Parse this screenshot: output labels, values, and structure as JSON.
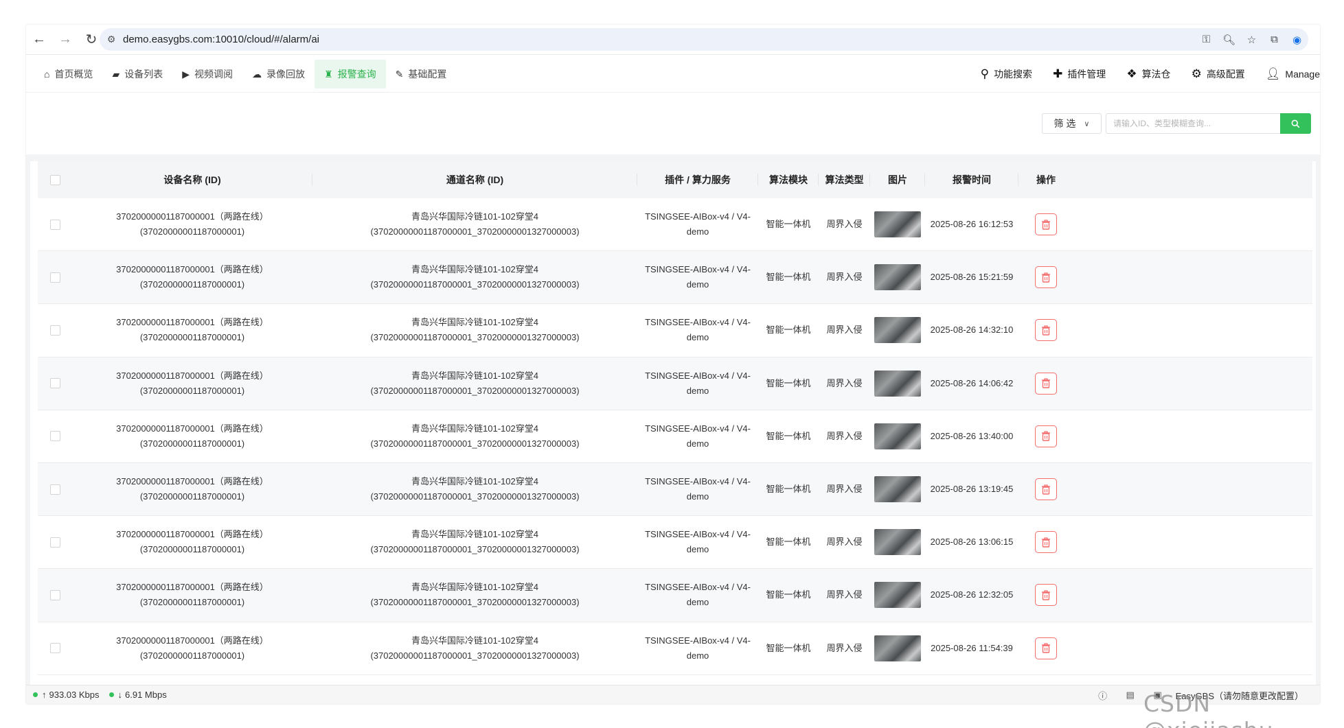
{
  "browser": {
    "url": "demo.easygbs.com:10010/cloud/#/alarm/ai"
  },
  "nav": {
    "left": [
      {
        "label": "首页概览",
        "icon": "home-icon"
      },
      {
        "label": "设备列表",
        "icon": "camera-icon"
      },
      {
        "label": "视频调阅",
        "icon": "play-icon"
      },
      {
        "label": "录像回放",
        "icon": "cloud-icon"
      },
      {
        "label": "报警查询",
        "icon": "alarm-icon",
        "active": true
      },
      {
        "label": "基础配置",
        "icon": "edit-icon"
      }
    ],
    "right": [
      {
        "label": "功能搜索",
        "icon": "search-icon"
      },
      {
        "label": "插件管理",
        "icon": "puzzle-icon"
      },
      {
        "label": "算法仓",
        "icon": "dropbox-icon"
      },
      {
        "label": "高级配置",
        "icon": "gear-icon"
      },
      {
        "label": "Manage",
        "icon": "user-icon"
      }
    ]
  },
  "filter": {
    "select_label": "筛 选",
    "search_placeholder": "请输入ID、类型模糊查询..."
  },
  "table": {
    "headers": {
      "device": "设备名称 (ID)",
      "channel": "通道名称 (ID)",
      "plugin": "插件 / 算力服务",
      "module": "算法模块",
      "type": "算法类型",
      "image": "图片",
      "time": "报警时间",
      "action": "操作"
    },
    "rows": [
      {
        "device": "37020000001187000001（两路在线） (37020000001187000001)",
        "channel": "青岛兴华国际冷链101-102穿堂4 (37020000001187000001_37020000001327000003)",
        "plugin_line1": "TSINGSEE-AIBox-v4 / V4-",
        "plugin_line2": "demo",
        "module": "智能一体机",
        "type": "周界入侵",
        "time": "2025-08-26 16:12:53"
      },
      {
        "device": "37020000001187000001（两路在线） (37020000001187000001)",
        "channel": "青岛兴华国际冷链101-102穿堂4 (37020000001187000001_37020000001327000003)",
        "plugin_line1": "TSINGSEE-AIBox-v4 / V4-",
        "plugin_line2": "demo",
        "module": "智能一体机",
        "type": "周界入侵",
        "time": "2025-08-26 15:21:59"
      },
      {
        "device": "37020000001187000001（两路在线） (37020000001187000001)",
        "channel": "青岛兴华国际冷链101-102穿堂4 (37020000001187000001_37020000001327000003)",
        "plugin_line1": "TSINGSEE-AIBox-v4 / V4-",
        "plugin_line2": "demo",
        "module": "智能一体机",
        "type": "周界入侵",
        "time": "2025-08-26 14:32:10"
      },
      {
        "device": "37020000001187000001（两路在线） (37020000001187000001)",
        "channel": "青岛兴华国际冷链101-102穿堂4 (37020000001187000001_37020000001327000003)",
        "plugin_line1": "TSINGSEE-AIBox-v4 / V4-",
        "plugin_line2": "demo",
        "module": "智能一体机",
        "type": "周界入侵",
        "time": "2025-08-26 14:06:42"
      },
      {
        "device": "37020000001187000001（两路在线） (37020000001187000001)",
        "channel": "青岛兴华国际冷链101-102穿堂4 (37020000001187000001_37020000001327000003)",
        "plugin_line1": "TSINGSEE-AIBox-v4 / V4-",
        "plugin_line2": "demo",
        "module": "智能一体机",
        "type": "周界入侵",
        "time": "2025-08-26 13:40:00"
      },
      {
        "device": "37020000001187000001（两路在线） (37020000001187000001)",
        "channel": "青岛兴华国际冷链101-102穿堂4 (37020000001187000001_37020000001327000003)",
        "plugin_line1": "TSINGSEE-AIBox-v4 / V4-",
        "plugin_line2": "demo",
        "module": "智能一体机",
        "type": "周界入侵",
        "time": "2025-08-26 13:19:45"
      },
      {
        "device": "37020000001187000001（两路在线） (37020000001187000001)",
        "channel": "青岛兴华国际冷链101-102穿堂4 (37020000001187000001_37020000001327000003)",
        "plugin_line1": "TSINGSEE-AIBox-v4 / V4-",
        "plugin_line2": "demo",
        "module": "智能一体机",
        "type": "周界入侵",
        "time": "2025-08-26 13:06:15"
      },
      {
        "device": "37020000001187000001（两路在线） (37020000001187000001)",
        "channel": "青岛兴华国际冷链101-102穿堂4 (37020000001187000001_37020000001327000003)",
        "plugin_line1": "TSINGSEE-AIBox-v4 / V4-",
        "plugin_line2": "demo",
        "module": "智能一体机",
        "type": "周界入侵",
        "time": "2025-08-26 12:32:05"
      },
      {
        "device": "37020000001187000001（两路在线） (37020000001187000001)",
        "channel": "青岛兴华国际冷链101-102穿堂4 (37020000001187000001_37020000001327000003)",
        "plugin_line1": "TSINGSEE-AIBox-v4 / V4-",
        "plugin_line2": "demo",
        "module": "智能一体机",
        "type": "周界入侵",
        "time": "2025-08-26 11:54:39"
      }
    ]
  },
  "status": {
    "upload": "933.03 Kbps",
    "download": "6.91 Mbps",
    "app_label": "EasyGBS（请勿随意更改配置）"
  },
  "watermark": "CSDN @xiejiashu",
  "colors": {
    "accent": "#32c15a",
    "danger": "#f56c6c"
  }
}
